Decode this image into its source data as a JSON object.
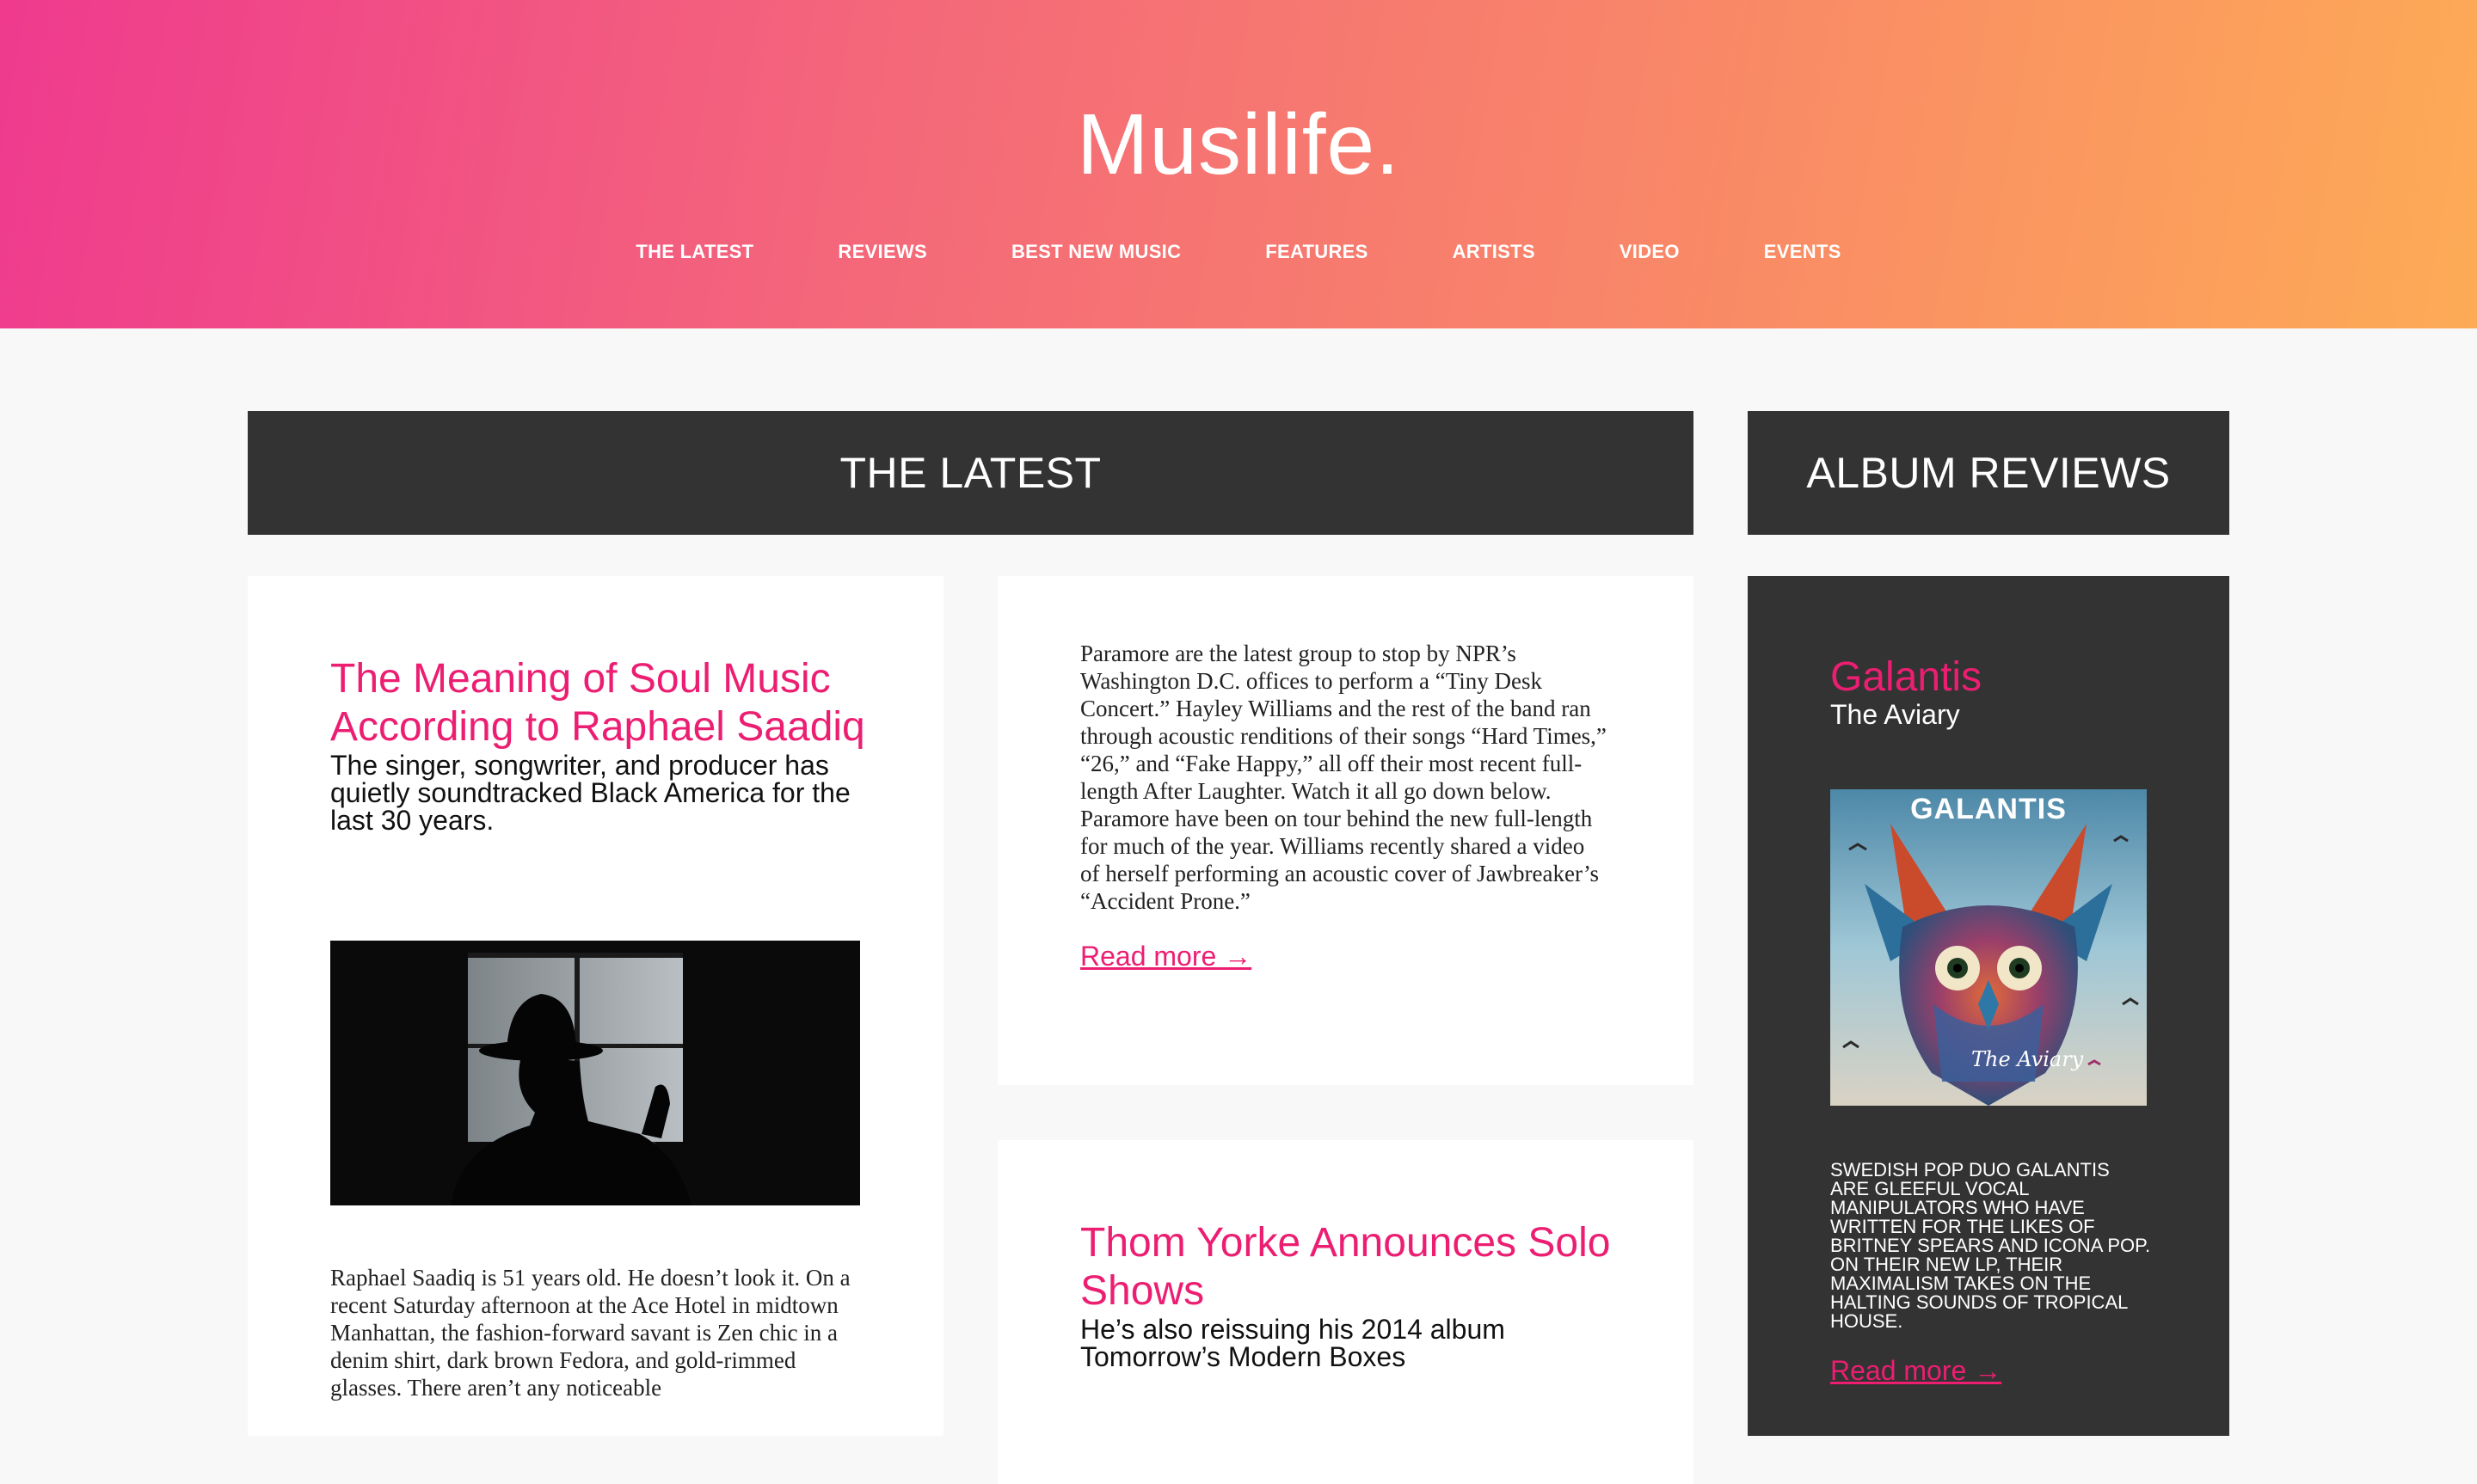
{
  "site": {
    "logo": "Musilife.",
    "nav": [
      "THE LATEST",
      "REVIEWS",
      "BEST NEW MUSIC",
      "FEATURES",
      "ARTISTS",
      "VIDEO",
      "EVENTS"
    ]
  },
  "sections": {
    "latest": "THE LATEST",
    "reviews": "ALBUM REVIEWS"
  },
  "articles": [
    {
      "title": "The Meaning of Soul Music According to Raphael Saadiq",
      "subtitle": "The singer, songwriter, and producer has quietly soundtracked Black America for the last 30 years.",
      "body": "Raphael Saadiq is 51 years old. He doesn’t look it. On a recent Saturday afternoon at the Ace Hotel in midtown Manhattan, the fashion-forward savant is Zen chic in a denim shirt, dark brown Fedora, and gold-rimmed glasses. There aren’t any noticeable"
    },
    {
      "body": "Paramore are the latest group to stop by NPR’s Washington D.C. offices to perform a “Tiny Desk Concert.” Hayley Williams and the rest of the band ran through acoustic renditions of their songs “Hard Times,” “26,” and “Fake Happy,” all off their most recent full-length After Laughter. Watch it all go down below. Paramore have been on tour behind the new full-length for much of the year. Williams recently shared a video of herself performing an acoustic cover of Jawbreaker’s “Accident Prone.”",
      "read_more": "Read more →"
    },
    {
      "title": "Thom Yorke Announces Solo Shows",
      "subtitle": "He’s also reissuing his 2014 album Tomorrow’s Modern Boxes"
    }
  ],
  "review": {
    "artist": "Galantis",
    "album": "The Aviary",
    "cover_text": "GALANTIS",
    "cover_script": "The Aviary",
    "blurb": "SWEDISH POP DUO GALANTIS ARE GLEEFUL VOCAL MANIPULATORS WHO HAVE WRITTEN FOR THE LIKES OF BRITNEY SPEARS AND ICONA POP. ON THEIR NEW LP, THEIR MAXIMALISM TAKES ON THE HALTING SOUNDS OF TROPICAL HOUSE.",
    "read_more": "Read more →"
  },
  "colors": {
    "accent": "#ec1e72",
    "dark": "#333333",
    "gradient_start": "#ef3a8e",
    "gradient_end": "#fdab56"
  }
}
